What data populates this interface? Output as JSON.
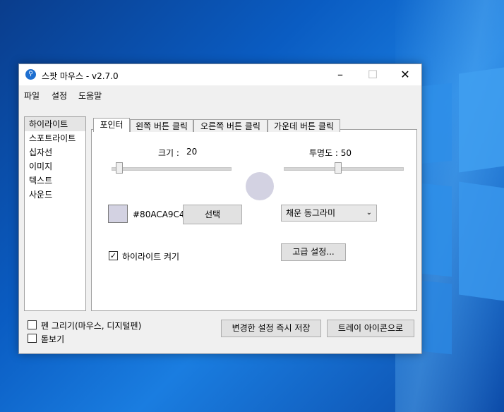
{
  "window": {
    "title": "스팟 마우스 - v2.7.0",
    "icon": "app-icon",
    "controls": {
      "minimize": "–",
      "maximize": "☐",
      "close": "✕"
    }
  },
  "menu": [
    "파일",
    "설정",
    "도움말"
  ],
  "sidebar": {
    "items": [
      {
        "label": "하이라이트",
        "selected": true
      },
      {
        "label": "스포트라이트"
      },
      {
        "label": "십자선"
      },
      {
        "label": "이미지"
      },
      {
        "label": "텍스트"
      },
      {
        "label": "사운드"
      }
    ]
  },
  "tabs": [
    {
      "label": "포인터",
      "active": true
    },
    {
      "label": "왼쪽 버튼 클릭"
    },
    {
      "label": "오른쪽 버튼 클릭"
    },
    {
      "label": "가운데 버튼 클릭"
    }
  ],
  "pointer": {
    "size_label": "크기 :",
    "size_value": "20",
    "opacity_label": "투명도 : 50",
    "color_hex": "#80ACA9C4",
    "select_button": "선택",
    "shape_selected": "채운 동그라미",
    "highlight_checkbox_label": "하이라이트 켜기",
    "highlight_checked": true,
    "advanced_button": "고급 설정...",
    "preview_color": "#d3d2e2"
  },
  "footer": {
    "pen_label": "펜 그리기(마우스, 디지털펜)",
    "zoom_label": "돋보기",
    "save_button": "변경한 설정 즉시 저장",
    "tray_button": "트레이 아이콘으로"
  }
}
